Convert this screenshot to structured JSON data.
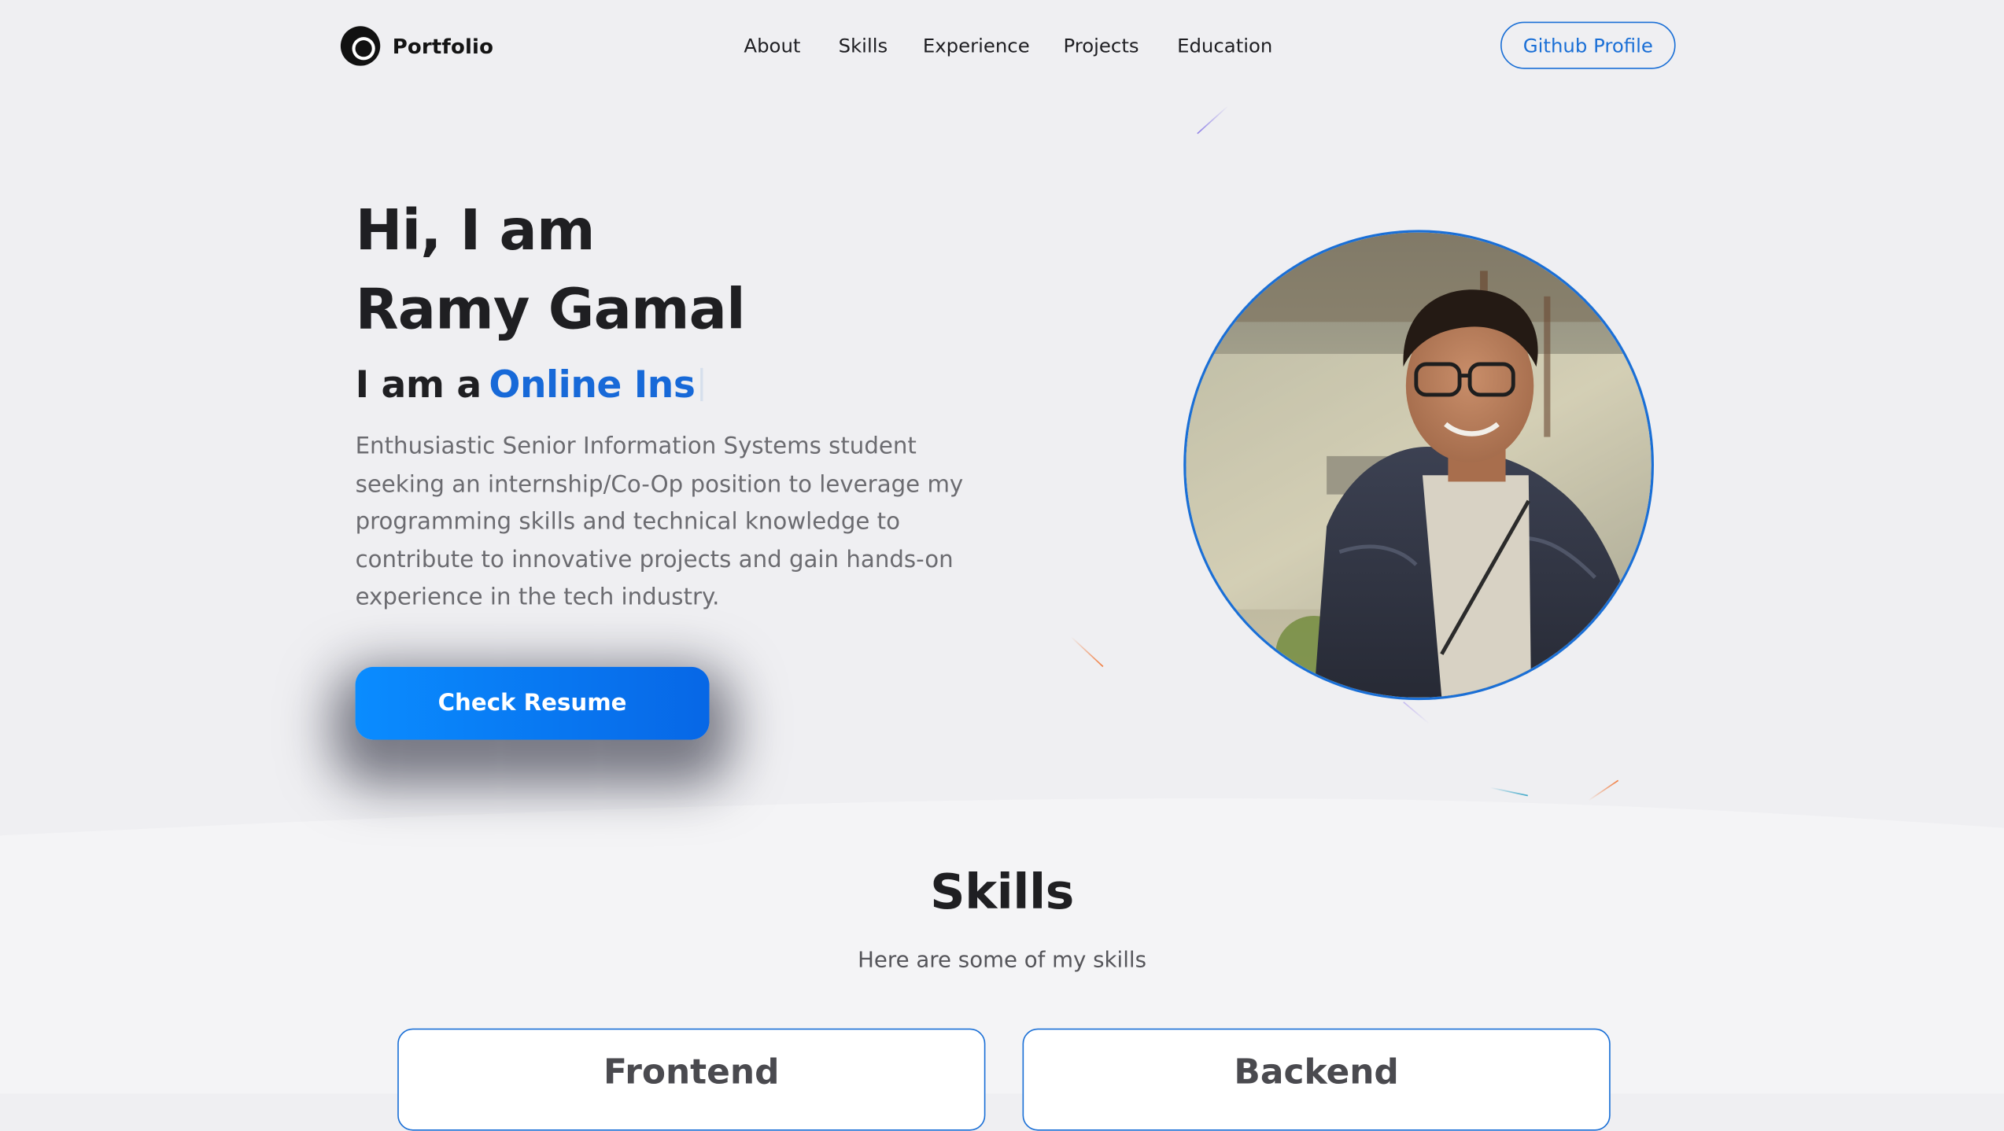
{
  "header": {
    "logo_text": "Portfolio",
    "nav": [
      {
        "label": "About"
      },
      {
        "label": "Skills"
      },
      {
        "label": "Experience"
      },
      {
        "label": "Projects"
      },
      {
        "label": "Education"
      }
    ],
    "github_label": "Github Profile"
  },
  "hero": {
    "greeting_line1": "Hi, I am",
    "greeting_line2": "Ramy Gamal",
    "role_prefix": "I am a",
    "role_typed": "Online Ins",
    "description": "Enthusiastic Senior Information Systems student seeking an internship/Co-Op position to leverage my programming skills and technical knowledge to contribute to innovative projects and gain hands-on experience in the tech industry.",
    "resume_label": "Check Resume"
  },
  "skills": {
    "title": "Skills",
    "subtitle": "Here are some of my skills",
    "cards": [
      {
        "title": "Frontend"
      },
      {
        "title": "Backend"
      }
    ]
  },
  "colors": {
    "accent": "#1769d8",
    "page_bg": "#efeff2",
    "section_bg": "#f4f4f6",
    "button_gradient_start": "#0a8cff",
    "button_gradient_end": "#0767e6"
  },
  "icons": {
    "logo": "portfolio-logo-icon"
  }
}
